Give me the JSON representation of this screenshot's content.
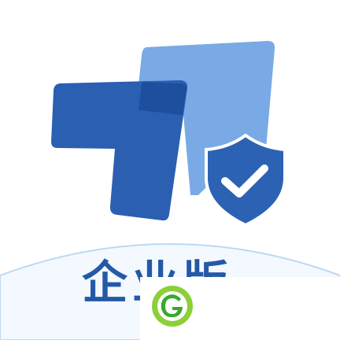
{
  "app": {
    "name": "企业版"
  },
  "logo": {
    "icon": "stacked-cards-shield-check-icon",
    "colors": {
      "light_panel": "#7aaae6",
      "dark_panel": "#2a5fb2",
      "overlap": "#1e4f9e",
      "shield": "#2c62b4",
      "check": "#ffffff",
      "arc": "#bcd9f2",
      "arc_fill": "#f3f9fe"
    }
  },
  "badge": {
    "icon": "leaf-g-icon",
    "colors": {
      "ring": "#8ccf3a",
      "inner": "#3aa82c"
    }
  }
}
